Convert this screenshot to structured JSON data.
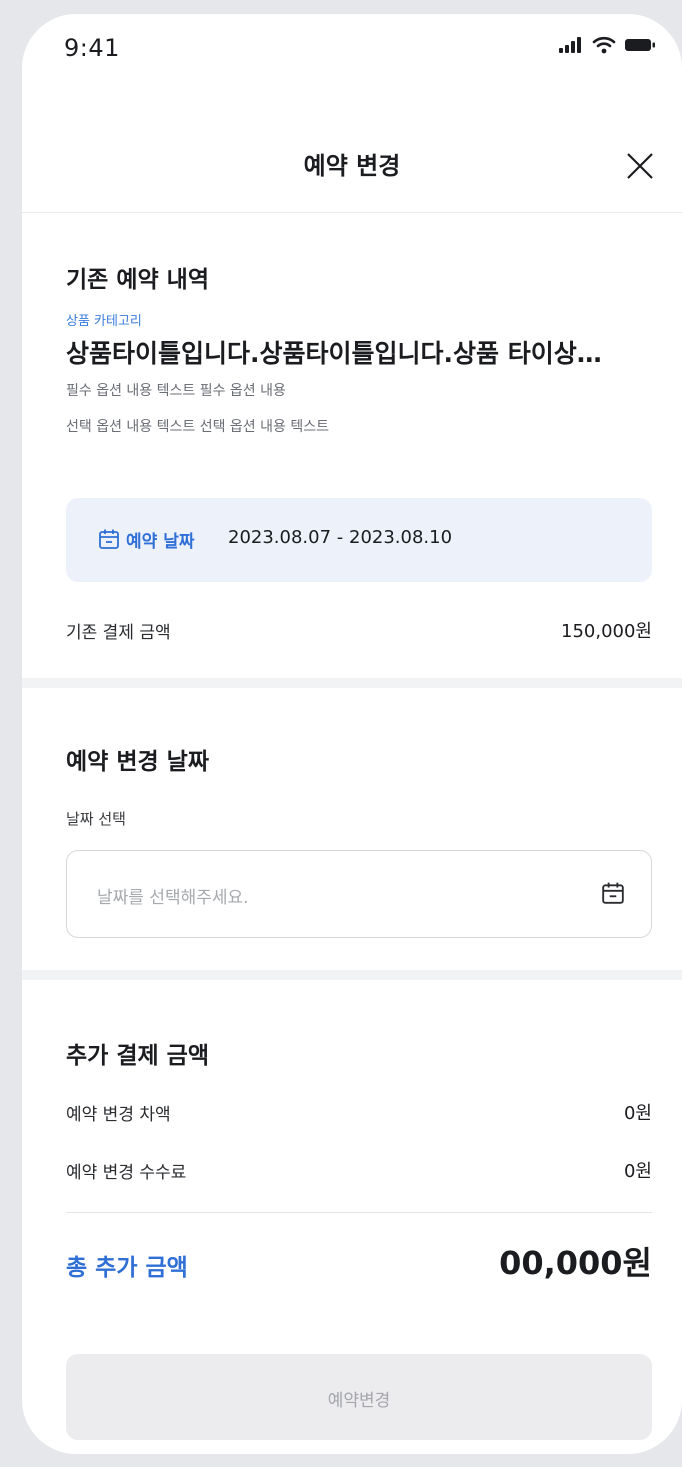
{
  "status_bar": {
    "time": "9:41"
  },
  "header": {
    "title": "예약 변경"
  },
  "existing": {
    "section_title": "기존 예약 내역",
    "category": "상품 카테고리",
    "product_title": "상품타이틀입니다.상품타이틀입니다.상품 타이상…",
    "required_option": "필수 옵션 내용 텍스트 필수 옵션 내용",
    "optional_option": "선택 옵션 내용 텍스트 선택 옵션 내용 텍스트",
    "date_label": "예약 날짜",
    "date_value": "2023.08.07 - 2023.08.10",
    "paid_label": "기존 결제 금액",
    "paid_value": "150,000원"
  },
  "change_date": {
    "section_title": "예약 변경 날짜",
    "field_label": "날짜 선택",
    "placeholder": "날짜를 선택해주세요."
  },
  "extra": {
    "section_title": "추가 결제 금액",
    "rows": [
      {
        "label": "예약 변경 차액",
        "value": "0원"
      },
      {
        "label": "예약 변경 수수료",
        "value": "0원"
      }
    ],
    "total_label": "총 추가 금액",
    "total_value": "00,000원"
  },
  "cta": {
    "label": "예약변경"
  },
  "colors": {
    "accent": "#2f6fd6",
    "date_box_bg": "#edf2fa",
    "disabled_bg": "#ececee"
  },
  "icons": [
    "signal-icon",
    "wifi-icon",
    "battery-icon",
    "close-icon",
    "calendar-icon"
  ]
}
